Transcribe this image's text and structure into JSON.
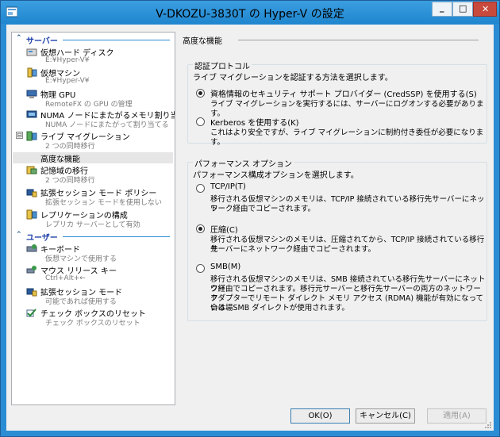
{
  "window": {
    "title": "V-DKOZU-3830T の Hyper-V の設定",
    "minimize_glyph": "_",
    "maximize_glyph": "□",
    "close_glyph": "✕"
  },
  "sidebar": {
    "server_category": "サーバー",
    "user_category": "ユーザー",
    "collapse_glyph": "⊟",
    "items": [
      {
        "label": "仮想ハード ディスク",
        "sub": "E:¥Hyper-V¥",
        "icon": "hard-disk-icon"
      },
      {
        "label": "仮想マシン",
        "sub": "E:¥Hyper-V¥",
        "icon": "virtual-machine-icon"
      },
      {
        "label": "物理 GPU",
        "sub": "RemoteFX の GPU の管理",
        "icon": "gpu-icon"
      },
      {
        "label": "NUMA ノードにまたがるメモリ割り当て",
        "sub": "NUMA ノードにまたがって割り当てる",
        "icon": "numa-icon"
      },
      {
        "label": "ライブ マイグレーション",
        "sub": "2 つの同時移行",
        "icon": "live-migration-icon"
      },
      {
        "label": "高度な機能",
        "sub": "",
        "icon": ""
      },
      {
        "label": "記憶域の移行",
        "sub": "2 つの同時移行",
        "icon": "storage-migration-icon"
      },
      {
        "label": "拡張セッション モード ポリシー",
        "sub": "拡張セッション モードを使用しない",
        "icon": "session-policy-icon"
      },
      {
        "label": "レプリケーションの構成",
        "sub": "レプリカ サーバーとして有効",
        "icon": "replication-icon"
      }
    ],
    "user_items": [
      {
        "label": "キーボード",
        "sub": "仮想マシンで使用する",
        "icon": "keyboard-icon"
      },
      {
        "label": "マウス リリース キー",
        "sub": "Ctrl+Alt+←",
        "icon": "mouse-release-icon"
      },
      {
        "label": "拡張セッション モード",
        "sub": "可能であれば使用する",
        "icon": "session-mode-icon"
      },
      {
        "label": "チェック ボックスのリセット",
        "sub": "チェック ボックスのリセット",
        "icon": "checkbox-reset-icon"
      }
    ]
  },
  "main": {
    "heading": "高度な機能",
    "auth": {
      "title": "認証プロトコル",
      "desc": "ライブ マイグレーションを認証する方法を選択します。",
      "credssp_label": "資格情報のセキュリティ サポート プロバイダー (CredSSP) を使用する(S)",
      "credssp_desc": "ライブ マイグレーションを実行するには、サーバーにログオンする必要があります。",
      "kerberos_label": "Kerberos を使用する(K)",
      "kerberos_desc": "これはより安全ですが、ライブ マイグレーションに制約付き委任が必要になります。",
      "selected": "credssp"
    },
    "perf": {
      "title": "パフォーマンス オプション",
      "desc": "パフォーマンス構成オプションを選択します。",
      "tcpip_label": "TCP/IP(T)",
      "tcpip_desc_1": "移行される仮想マシンのメモリは、TCP/IP 接続されている移行先サーバーにネット",
      "tcpip_desc_2": "ワーク経由でコピーされます。",
      "compress_label": "圧縮(C)",
      "compress_desc_1": "移行される仮想マシンのメモリは、圧縮されてから、TCP/IP 接続されている移行先",
      "compress_desc_2": "サーバーにネットワーク経由でコピーされます。",
      "smb_label": "SMB(M)",
      "smb_desc_1": "移行される仮想マシンのメモリは、SMB 接続されている移行先サーバーにネットワー",
      "smb_desc_2": "ク経由でコピーされます。移行元サーバーと移行先サーバーの両方のネットワーク",
      "smb_desc_3": "アダプターでリモート ダイレクト メモリ アクセス (RDMA) 機能が有効になっている場",
      "smb_desc_4": "合は、SMB ダイレクトが使用されます。",
      "selected": "compress"
    }
  },
  "buttons": {
    "ok": "OK(O)",
    "cancel": "キャンセル(C)",
    "apply": "適用(A)"
  },
  "colors": {
    "title_bar": "#2a8dd4",
    "category_text": "#1c3fa8",
    "close_button": "#c74a3d"
  }
}
